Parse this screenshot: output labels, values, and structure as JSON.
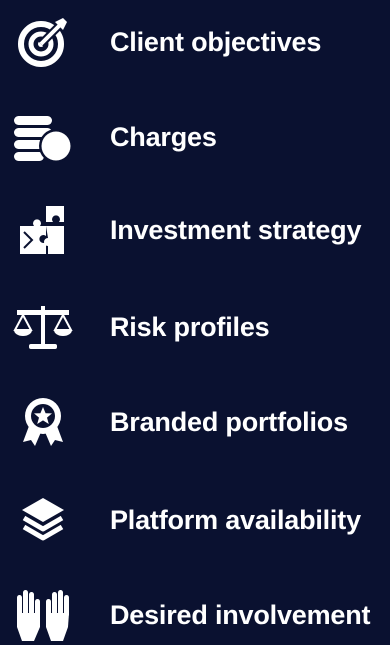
{
  "items": [
    {
      "label": "Client objectives",
      "icon": "target-icon"
    },
    {
      "label": "Charges",
      "icon": "coins-icon"
    },
    {
      "label": "Investment strategy",
      "icon": "puzzle-icon"
    },
    {
      "label": "Risk profiles",
      "icon": "scales-icon"
    },
    {
      "label": "Branded portfolios",
      "icon": "award-badge-icon"
    },
    {
      "label": "Platform availability",
      "icon": "layers-icon"
    },
    {
      "label": "Desired involvement",
      "icon": "raised-hands-icon"
    }
  ],
  "colors": {
    "background": "#0a1130",
    "foreground": "#ffffff"
  }
}
